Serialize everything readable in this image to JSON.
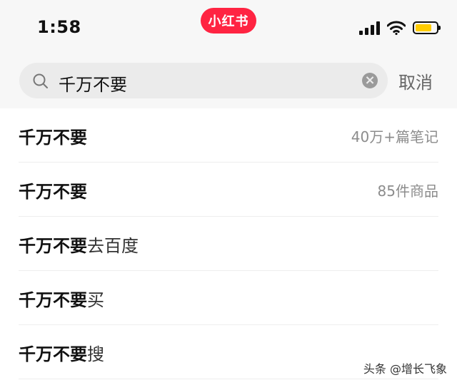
{
  "status_bar": {
    "time": "1:58",
    "logo_text": "小红书",
    "battery_level": 0.8,
    "colors": {
      "logo": "#ff2442",
      "battery": "#ffcc00"
    }
  },
  "search": {
    "query": "千万不要",
    "cancel_label": "取消"
  },
  "suggestions": [
    {
      "highlight": "千万不要",
      "rest": "",
      "meta": "40万+篇笔记"
    },
    {
      "highlight": "千万不要",
      "rest": "",
      "meta": "85件商品"
    },
    {
      "highlight": "千万不要",
      "rest": "去百度",
      "meta": ""
    },
    {
      "highlight": "千万不要",
      "rest": "买",
      "meta": ""
    },
    {
      "highlight": "千万不要",
      "rest": "搜",
      "meta": ""
    }
  ],
  "watermark": "头条 @增长飞象",
  "icons": [
    "search-icon",
    "clear-icon",
    "signal-icon",
    "wifi-icon",
    "battery-icon"
  ]
}
